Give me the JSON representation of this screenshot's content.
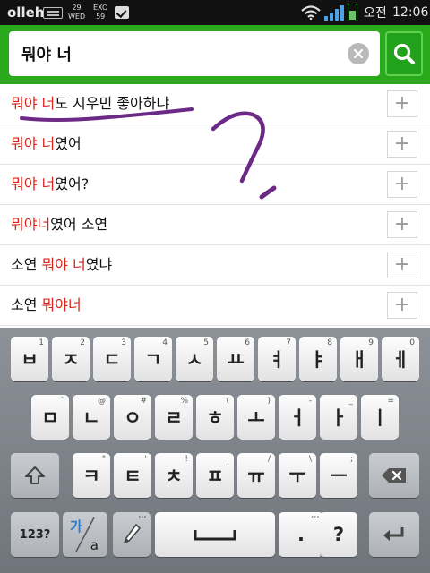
{
  "status_bar": {
    "carrier": "olleh",
    "calendar_day": "29",
    "calendar_weekday": "WED",
    "exo_label": "EXO",
    "exo_count": "59",
    "ampm": "오전",
    "time": "12:06"
  },
  "search": {
    "query": "뭐야 너",
    "clear_icon": "close-icon",
    "search_icon": "search-icon"
  },
  "suggestions": [
    {
      "highlight": "뭐야 너",
      "rest": "도 시우민 좋아하냐"
    },
    {
      "highlight": "뭐야 너",
      "rest": "였어"
    },
    {
      "highlight": "뭐야 너",
      "rest": "였어?"
    },
    {
      "prefix": "",
      "highlight": "뭐야너",
      "rest": "였어 소연"
    },
    {
      "prefix": "소연 ",
      "highlight": "뭐야 너",
      "rest": "였냐"
    },
    {
      "prefix": "소연 ",
      "highlight": "뭐야너",
      "rest": ""
    }
  ],
  "suggestion_plus_label": "+",
  "keyboard": {
    "row1": [
      {
        "main": "ㅂ",
        "sub": "1"
      },
      {
        "main": "ㅈ",
        "sub": "2"
      },
      {
        "main": "ㄷ",
        "sub": "3"
      },
      {
        "main": "ㄱ",
        "sub": "4"
      },
      {
        "main": "ㅅ",
        "sub": "5"
      },
      {
        "main": "ㅛ",
        "sub": "6"
      },
      {
        "main": "ㅕ",
        "sub": "7"
      },
      {
        "main": "ㅑ",
        "sub": "8"
      },
      {
        "main": "ㅐ",
        "sub": "9"
      },
      {
        "main": "ㅔ",
        "sub": "0"
      }
    ],
    "row2": [
      {
        "main": "ㅁ",
        "sub": "`"
      },
      {
        "main": "ㄴ",
        "sub": "@"
      },
      {
        "main": "ㅇ",
        "sub": "#"
      },
      {
        "main": "ㄹ",
        "sub": "%"
      },
      {
        "main": "ㅎ",
        "sub": "("
      },
      {
        "main": "ㅗ",
        "sub": ")"
      },
      {
        "main": "ㅓ",
        "sub": "-"
      },
      {
        "main": "ㅏ",
        "sub": "_"
      },
      {
        "main": "ㅣ",
        "sub": "="
      }
    ],
    "row3": [
      {
        "main": "ㅋ",
        "sub": "\""
      },
      {
        "main": "ㅌ",
        "sub": "'"
      },
      {
        "main": "ㅊ",
        "sub": "!"
      },
      {
        "main": "ㅍ",
        "sub": ","
      },
      {
        "main": "ㅠ",
        "sub": "/"
      },
      {
        "main": "ㅜ",
        "sub": "\\"
      },
      {
        "main": "ㅡ",
        "sub": ";"
      }
    ],
    "symbols_label": "123?",
    "lang_label_top": "가",
    "lang_label_bottom": "a",
    "period_label": ".",
    "question_label": "?",
    "period_sub": "•••"
  },
  "colors": {
    "brand_green": "#2aa91d",
    "highlight_red": "#d8261d",
    "scribble_purple": "#6b2a86"
  }
}
